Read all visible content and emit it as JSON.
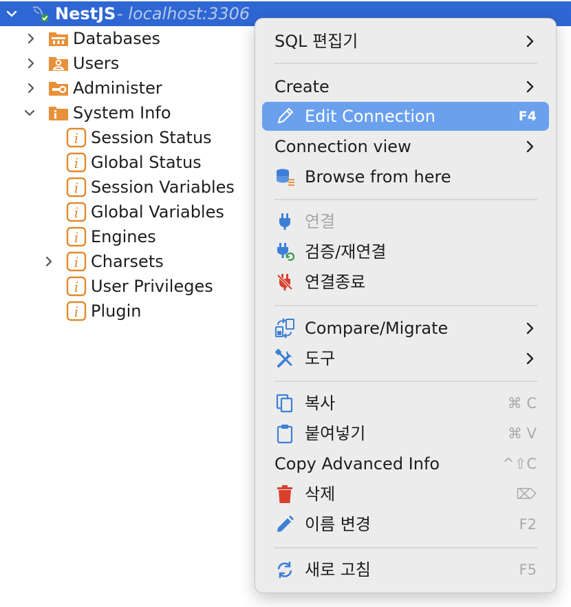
{
  "tree": {
    "root": {
      "label": "NestJS",
      "host": " - localhost:3306"
    },
    "items": [
      {
        "label": "Databases"
      },
      {
        "label": "Users"
      },
      {
        "label": "Administer"
      },
      {
        "label": "System Info"
      }
    ],
    "system_info_children": [
      {
        "label": "Session Status"
      },
      {
        "label": "Global Status"
      },
      {
        "label": "Session Variables"
      },
      {
        "label": "Global Variables"
      },
      {
        "label": "Engines"
      },
      {
        "label": "Charsets"
      },
      {
        "label": "User Privileges"
      },
      {
        "label": "Plugin"
      }
    ]
  },
  "menu": {
    "sql_editor": "SQL 편집기",
    "create": "Create",
    "edit_connection": "Edit Connection",
    "edit_connection_shortcut": "F4",
    "connection_view": "Connection view",
    "browse_from_here": "Browse from here",
    "connect": "연결",
    "invalidate_reconnect": "검증/재연결",
    "disconnect": "연결종료",
    "compare_migrate": "Compare/Migrate",
    "tools": "도구",
    "copy": "복사",
    "copy_shortcut": "⌘ C",
    "paste": "붙여넣기",
    "paste_shortcut": "⌘ V",
    "copy_advanced_info": "Copy Advanced Info",
    "copy_advanced_shortcut": "^⇧C",
    "delete": "삭제",
    "delete_shortcut": "⌦",
    "rename": "이름 변경",
    "rename_shortcut": "F2",
    "refresh": "새로 고침",
    "refresh_shortcut": "F5"
  },
  "colors": {
    "selection": "#2e67d3",
    "highlight": "#6aa0ee",
    "folder_orange": "#e8913a",
    "info_orange": "#e08a2e",
    "menu_blue_icon": "#3d7fd6",
    "danger_red": "#d9402b"
  }
}
